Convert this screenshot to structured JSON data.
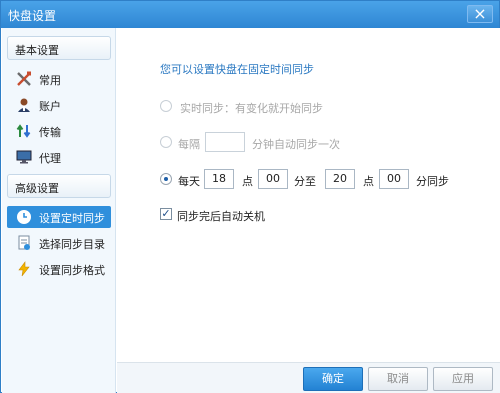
{
  "window": {
    "title": "快盘设置",
    "close_glyph": "×"
  },
  "sidebar": {
    "basic_header": "基本设置",
    "basic_items": [
      {
        "label": "常用",
        "icon": "tools-icon"
      },
      {
        "label": "账户",
        "icon": "user-icon"
      },
      {
        "label": "传输",
        "icon": "transfer-arrows-icon"
      },
      {
        "label": "代理",
        "icon": "monitor-icon"
      }
    ],
    "advanced_header": "高级设置",
    "advanced_items": [
      {
        "label": "设置定时同步",
        "icon": "clock-icon",
        "active": true
      },
      {
        "label": "选择同步目录",
        "icon": "folder-doc-icon"
      },
      {
        "label": "设置同步格式",
        "icon": "lightning-icon"
      }
    ]
  },
  "main": {
    "heading": "您可以设置快盘在固定时间同步",
    "realtime_label": "实时同步：有变化就开始同步",
    "interval_prefix": "每隔",
    "interval_value": "",
    "interval_suffix": "分钟自动同步一次",
    "daily_prefix": "每天",
    "start_hour": "18",
    "hour_unit_1": "点",
    "start_minute": "00",
    "to_label": "分至",
    "end_hour": "20",
    "hour_unit_2": "点",
    "end_minute": "00",
    "daily_suffix": "分同步",
    "shutdown_label": "同步完后自动关机",
    "shutdown_checked": true,
    "selected_mode": "daily"
  },
  "footer": {
    "ok": "确定",
    "cancel": "取消",
    "apply": "应用"
  },
  "colors": {
    "accent": "#2f8fdc",
    "heading": "#2b79c2",
    "titlebar": "#2e86d3"
  }
}
